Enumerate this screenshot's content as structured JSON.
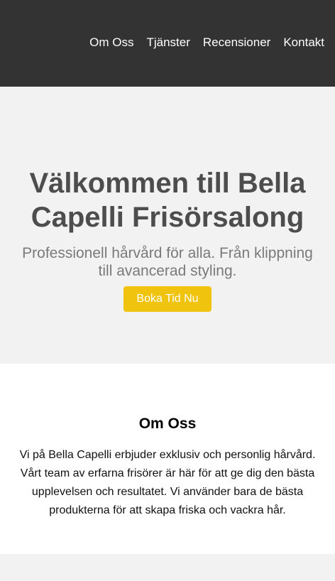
{
  "nav": {
    "items": [
      "Om Oss",
      "Tjänster",
      "Recensioner",
      "Kontakt"
    ]
  },
  "hero": {
    "title": "Välkommen till Bella Capelli Frisörsalong",
    "subtitle": "Professionell hårvård för alla. Från klippning till avancerad styling.",
    "cta_label": "Boka Tid Nu"
  },
  "about": {
    "title": "Om Oss",
    "text": "Vi på Bella Capelli erbjuder exklusiv och personlig hårvård. Vårt team av erfarna frisörer är här för att ge dig den bästa upplevelsen och resultatet. Vi använder bara de bästa produkterna för att skapa friska och vackra hår."
  },
  "colors": {
    "header_bg": "#333333",
    "accent": "#f0c30f",
    "section_bg": "#f2f2f2"
  }
}
